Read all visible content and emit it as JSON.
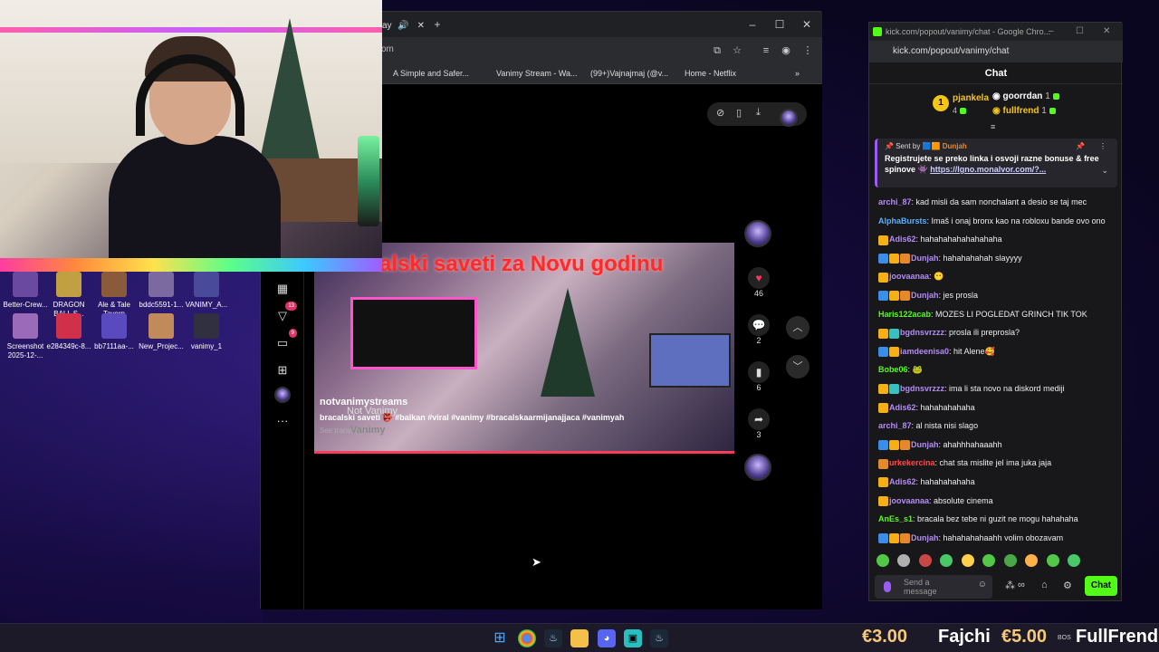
{
  "desktop": {
    "icons": [
      {
        "label": "Better-Crew...",
        "color": "#6a4aa0"
      },
      {
        "label": "DRAGON BALL S...",
        "color": "#c0a040"
      },
      {
        "label": "Ale & Tale Tavern",
        "color": "#8a5a3a"
      },
      {
        "label": "bddc5591-1...",
        "color": "#7a6aa0"
      },
      {
        "label": "VANIMY_A...",
        "color": "#4a4a9a"
      },
      {
        "label": "Screenshot 2025-12-...",
        "color": "#9b6ab8"
      },
      {
        "label": "e284349c-8...",
        "color": "#d0304a"
      },
      {
        "label": "bb7111aa-...",
        "color": "#5a4ac0"
      },
      {
        "label": "New_Projec...",
        "color": "#c08a5a"
      },
      {
        "label": "vanimy_1",
        "color": "#303040"
      }
    ]
  },
  "browser": {
    "tab_suffix": "ay",
    "url_fragment": "om",
    "bookmarks": [
      "A Simple and Safer...",
      "Vanimy Stream - Wa...",
      "(99+)Vajnajmaj (@v...",
      "Home - Netflix"
    ],
    "left_nav_badges": {
      "notifications": "13",
      "messages": "9"
    }
  },
  "video": {
    "overlay_title": "alski saveti za Novu godinu",
    "channel": "notvanimystreams",
    "watermark": "Not Vanimy",
    "watermark2": "Vanimy",
    "description": "bracalski saveti 👺 #balkan #viral #vanimy #bracalskaarmijanajjaca #vanimyah",
    "see_translation": "See translation",
    "likes": "46",
    "comments": "2",
    "saves": "6",
    "shares": "3"
  },
  "chat": {
    "window_title": "kick.com/popout/vanimy/chat - Google Chro...",
    "url": "kick.com/popout/vanimy/chat",
    "header": "Chat",
    "leaderboard": [
      {
        "rank": "1",
        "name": "pjankela",
        "count": "4",
        "color": "#f5c518"
      },
      {
        "name": "goorrdan",
        "count": "1",
        "color": "#ffffff"
      },
      {
        "name": "fullfrend",
        "count": "1",
        "color": "#f5c518"
      }
    ],
    "pinned": {
      "sent_by_label": "Sent by",
      "sent_by_user": "Dunjah",
      "message": "Registrujete se preko linka i osvoji razne bonuse & free spinove 👾",
      "link": "https://lgno.monalvor.com/?..."
    },
    "messages": [
      {
        "user": "archi_87",
        "color": "#b38cf5",
        "badges": [],
        "text": ": kad misli da sam nonchalant a desio se taj mec"
      },
      {
        "user": "AlphaBursts",
        "color": "#5ab0ff",
        "badges": [],
        "text": ": Imaš i onaj bronx kao na robloxu bande ovo ono"
      },
      {
        "user": "Adis62",
        "color": "#b38cf5",
        "badges": [
          "#f5b018"
        ],
        "text": ": hahahahahahahahaha"
      },
      {
        "user": "Dunjah",
        "color": "#b38cf5",
        "badges": [
          "#3a8ee8",
          "#f5b018",
          "#e48a2c"
        ],
        "text": ": hahahahahah slayyyy"
      },
      {
        "user": "joovaanaa",
        "color": "#b38cf5",
        "badges": [
          "#f5b018"
        ],
        "text": ": 😶"
      },
      {
        "user": "Dunjah",
        "color": "#b38cf5",
        "badges": [
          "#3a8ee8",
          "#f5b018",
          "#e48a2c"
        ],
        "text": ": jes prosla"
      },
      {
        "user": "Haris122acab",
        "color": "#53fc18",
        "badges": [],
        "text": ": MOZES LI POGLEDAT GRINCH TIK TOK"
      },
      {
        "user": "bgdnsvrzzz",
        "color": "#b38cf5",
        "badges": [
          "#f5b018",
          "#3ac0c0"
        ],
        "text": ": prosla ili preprosla?"
      },
      {
        "user": "iamdeenisa0",
        "color": "#b38cf5",
        "badges": [
          "#3a8ee8",
          "#f5b018"
        ],
        "text": ": hit Alene🥰"
      },
      {
        "user": "Bobe06",
        "color": "#53fc18",
        "badges": [],
        "text": ": 🐸"
      },
      {
        "user": "bgdnsvrzzz",
        "color": "#b38cf5",
        "badges": [
          "#f5b018",
          "#3ac0c0"
        ],
        "text": ": ima li sta novo na diskord mediji"
      },
      {
        "user": "Adis62",
        "color": "#b38cf5",
        "badges": [
          "#f5b018"
        ],
        "text": ": hahahahahaha"
      },
      {
        "user": "archi_87",
        "color": "#b38cf5",
        "badges": [],
        "text": ": al nista nisi slago"
      },
      {
        "user": "Dunjah",
        "color": "#b38cf5",
        "badges": [
          "#3a8ee8",
          "#f5b018",
          "#e48a2c"
        ],
        "text": ": ahahhhahaaahh"
      },
      {
        "user": "urkekercina",
        "color": "#ff4a4a",
        "badges": [
          "#e48a2c"
        ],
        "text": ": chat sta mislite jel ima juka jaja"
      },
      {
        "user": "Adis62",
        "color": "#b38cf5",
        "badges": [
          "#f5b018"
        ],
        "text": ": hahahahahaha"
      },
      {
        "user": "joovaanaa",
        "color": "#b38cf5",
        "badges": [
          "#f5b018"
        ],
        "text": ": absolute cinema"
      },
      {
        "user": "AnEs_s1",
        "color": "#53fc18",
        "badges": [],
        "text": ": bracala bez tebe ni guzit ne mogu hahahaha"
      },
      {
        "user": "Dunjah",
        "color": "#b38cf5",
        "badges": [
          "#3a8ee8",
          "#f5b018",
          "#e48a2c"
        ],
        "text": ": hahahahahaahh volim obozavam"
      }
    ],
    "input_placeholder": "Send a message",
    "send_label": "Chat"
  },
  "ticker": {
    "amount1": "€3.00",
    "name1": "Fajchi",
    "amount2": "€5.00",
    "small": "BOS",
    "name2": "FullFrend"
  }
}
